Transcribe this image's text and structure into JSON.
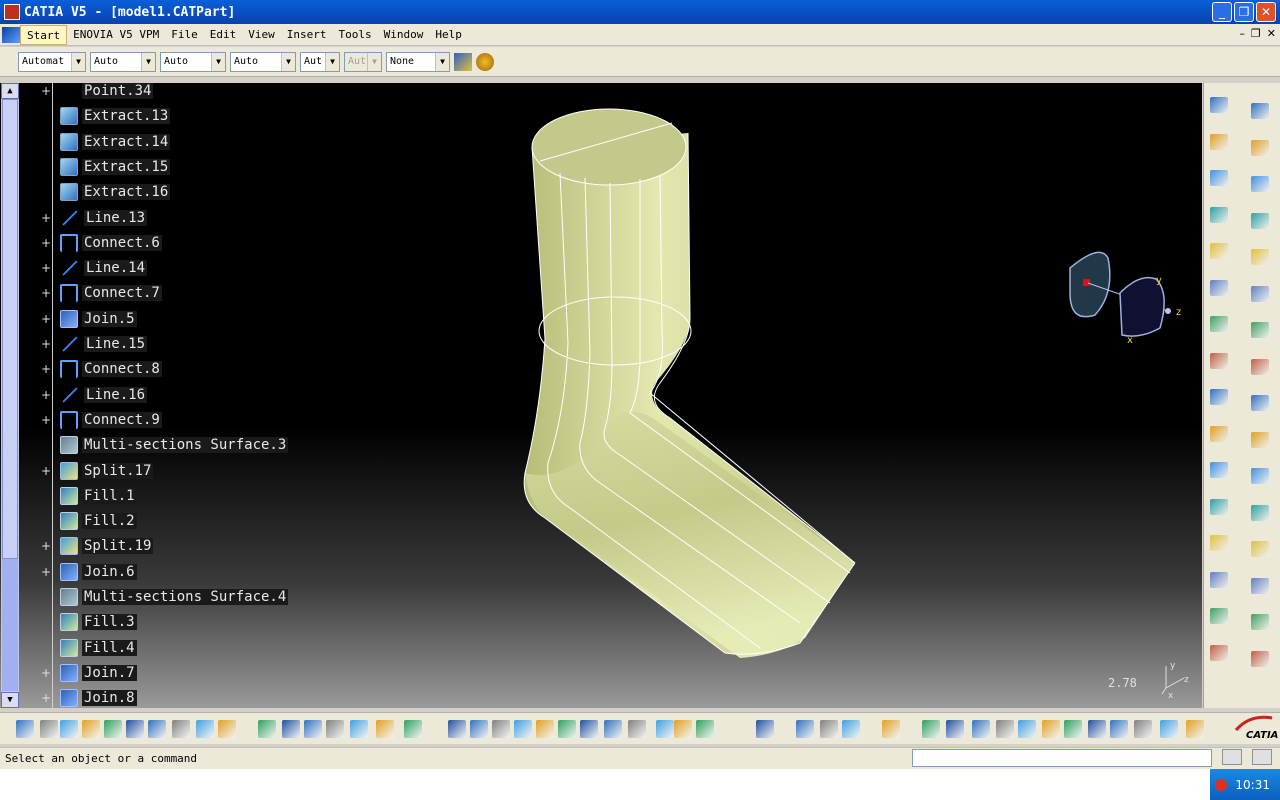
{
  "window": {
    "title": "CATIA V5 - [model1.CATPart]",
    "min_label": "_",
    "max_label": "❐",
    "close_label": "✕"
  },
  "menu": {
    "items": [
      "Start",
      "ENOVIA V5 VPM",
      "File",
      "Edit",
      "View",
      "Insert",
      "Tools",
      "Window",
      "Help"
    ],
    "doc_min": "–",
    "doc_restore": "❐",
    "doc_close": "✕"
  },
  "toolbar": {
    "combos": [
      {
        "value": "Automat",
        "enabled": true
      },
      {
        "value": "Auto",
        "enabled": true
      },
      {
        "value": "Auto",
        "enabled": true
      },
      {
        "value": "Auto",
        "enabled": true
      },
      {
        "value": "Aut",
        "enabled": true
      },
      {
        "value": "Aut",
        "enabled": false
      },
      {
        "value": "None",
        "enabled": true
      }
    ],
    "arrow": "▼"
  },
  "tree": {
    "items": [
      {
        "label": "Point.34",
        "icon": "point-icon",
        "expand": true
      },
      {
        "label": "Extract.13",
        "icon": "extract-icon",
        "expand": false
      },
      {
        "label": "Extract.14",
        "icon": "extract-icon",
        "expand": false
      },
      {
        "label": "Extract.15",
        "icon": "extract-icon",
        "expand": false
      },
      {
        "label": "Extract.16",
        "icon": "extract-icon",
        "expand": false
      },
      {
        "label": "Line.13",
        "icon": "line-icon",
        "expand": true
      },
      {
        "label": "Connect.6",
        "icon": "connect-icon",
        "expand": true
      },
      {
        "label": "Line.14",
        "icon": "line-icon",
        "expand": true
      },
      {
        "label": "Connect.7",
        "icon": "connect-icon",
        "expand": true
      },
      {
        "label": "Join.5",
        "icon": "join-icon",
        "expand": true
      },
      {
        "label": "Line.15",
        "icon": "line-icon",
        "expand": true
      },
      {
        "label": "Connect.8",
        "icon": "connect-icon",
        "expand": true
      },
      {
        "label": "Line.16",
        "icon": "line-icon",
        "expand": true
      },
      {
        "label": "Connect.9",
        "icon": "connect-icon",
        "expand": true
      },
      {
        "label": "Multi-sections Surface.3",
        "icon": "multi-sections-icon",
        "expand": false
      },
      {
        "label": "Split.17",
        "icon": "split-icon",
        "expand": true
      },
      {
        "label": "Fill.1",
        "icon": "fill-icon",
        "expand": false
      },
      {
        "label": "Fill.2",
        "icon": "fill-icon",
        "expand": false
      },
      {
        "label": "Split.19",
        "icon": "split-icon",
        "expand": true
      },
      {
        "label": "Join.6",
        "icon": "join-icon",
        "expand": true
      },
      {
        "label": "Multi-sections Surface.4",
        "icon": "multi-sections-icon",
        "expand": false
      },
      {
        "label": "Fill.3",
        "icon": "fill-icon",
        "expand": false
      },
      {
        "label": "Fill.4",
        "icon": "fill-icon",
        "expand": false
      },
      {
        "label": "Join.7",
        "icon": "join-icon",
        "expand": true
      },
      {
        "label": "Join.8",
        "icon": "join-icon",
        "expand": true
      }
    ],
    "expand_glyph": "+"
  },
  "viewport": {
    "scale_value": "2.78",
    "compass_x": "x",
    "compass_y": "y",
    "compass_z": "z",
    "mini_x": "x",
    "mini_y": "y",
    "mini_z": "z",
    "surface_color": "#d8dca0",
    "edge_color": "#ffffff"
  },
  "scrollbar": {
    "up": "▲",
    "down": "▼"
  },
  "status": {
    "message": "Select an object or a command",
    "clock": "10:31"
  },
  "logo": {
    "text": "CATIA"
  }
}
